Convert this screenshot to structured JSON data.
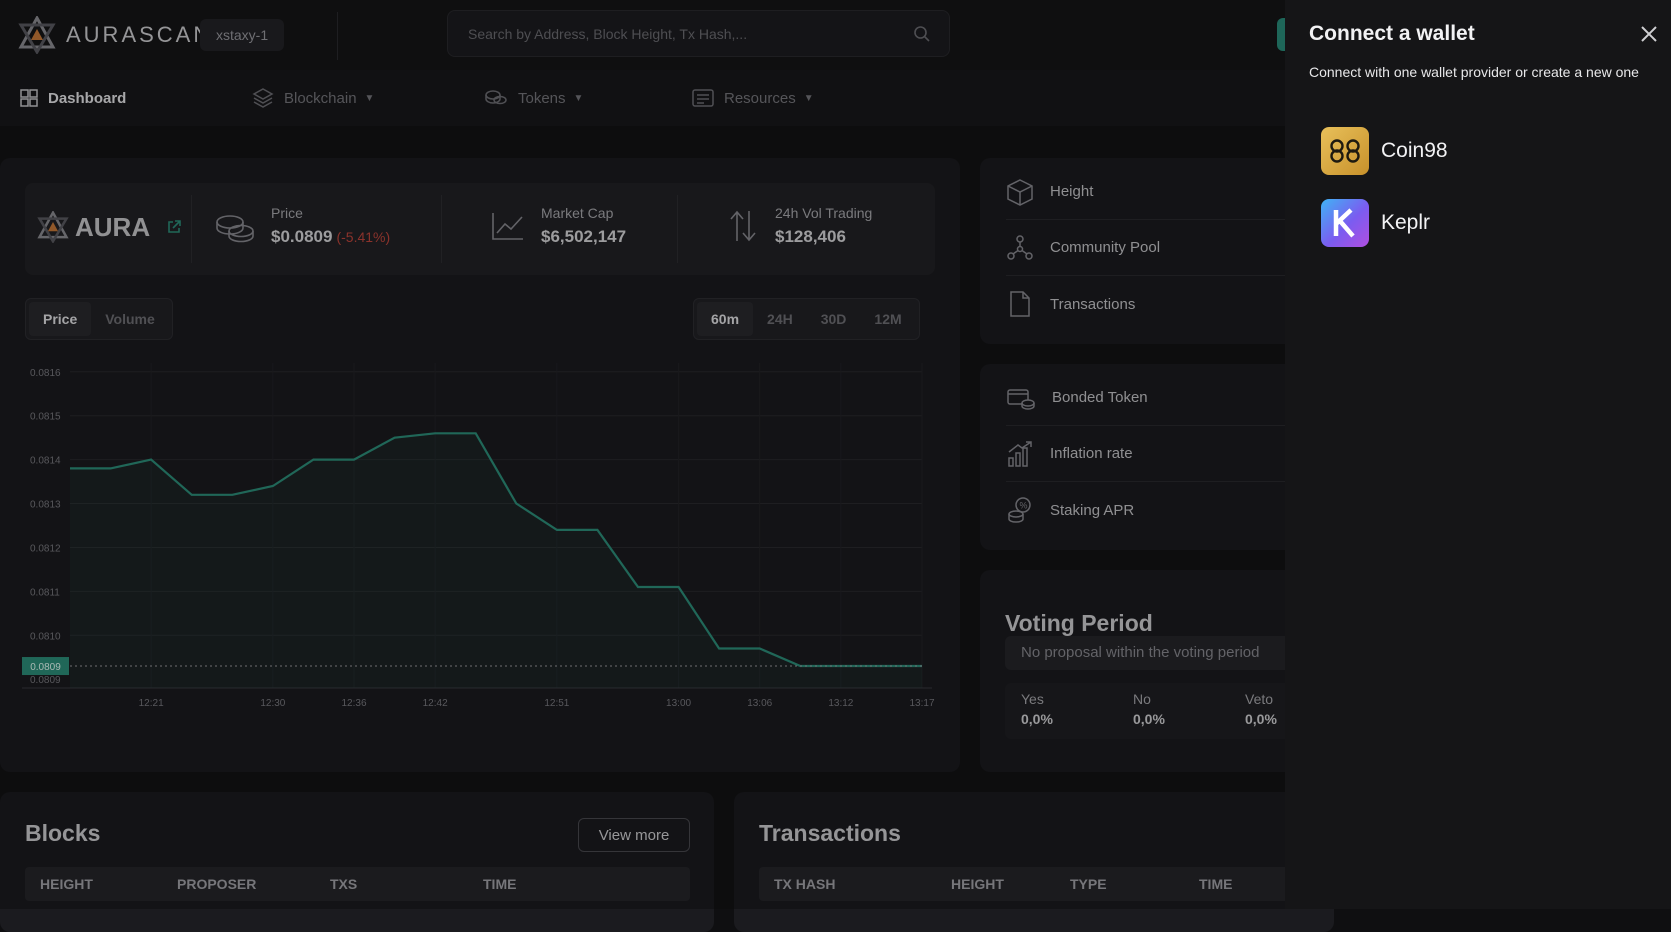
{
  "header": {
    "brand": "AURASCAN",
    "network": "xstaxy-1",
    "search_placeholder": "Search by Address, Block Height, Tx Hash,..."
  },
  "nav": {
    "dashboard": "Dashboard",
    "blockchain": "Blockchain",
    "tokens": "Tokens",
    "resources": "Resources"
  },
  "stats": {
    "token": "AURA",
    "price_label": "Price",
    "price_value": "$0.0809",
    "price_change": "(-5.41%)",
    "market_cap_label": "Market Cap",
    "market_cap_value": "$6,502,147",
    "volume_label": "24h Vol Trading",
    "volume_value": "$128,406"
  },
  "chart_toggle": {
    "price": "Price",
    "volume": "Volume"
  },
  "range_toggle": {
    "r60m": "60m",
    "r24h": "24H",
    "r30d": "30D",
    "r12m": "12M"
  },
  "chart_data": {
    "type": "area",
    "x": [
      "12:16",
      "12:18",
      "12:21",
      "12:24",
      "12:27",
      "12:30",
      "12:33",
      "12:36",
      "12:39",
      "12:42",
      "12:45",
      "12:48",
      "12:51",
      "12:54",
      "12:57",
      "13:00",
      "13:03",
      "13:06",
      "13:09",
      "13:12",
      "13:15",
      "13:17"
    ],
    "values": [
      0.08138,
      0.08138,
      0.0814,
      0.08132,
      0.08132,
      0.08134,
      0.0814,
      0.0814,
      0.08145,
      0.08146,
      0.08146,
      0.0813,
      0.08124,
      0.08124,
      0.08111,
      0.08111,
      0.08097,
      0.08097,
      0.08093,
      0.08093,
      0.08093,
      0.08093
    ],
    "yticks": [
      "0.0816",
      "0.0815",
      "0.0814",
      "0.0813",
      "0.0812",
      "0.0811",
      "0.0810",
      "0.0809"
    ],
    "xticks": [
      "12:21",
      "12:30",
      "12:36",
      "12:42",
      "12:51",
      "13:00",
      "13:06",
      "13:12",
      "13:17"
    ],
    "current_label": "0.0809",
    "current_value": 0.08093,
    "ylim": [
      0.08088,
      0.08162
    ],
    "grid": true,
    "line_color": "#2d8f7b"
  },
  "network_stats": {
    "height": "Height",
    "community_pool": "Community Pool",
    "transactions": "Transactions"
  },
  "staking_stats": {
    "bonded": "Bonded Token",
    "inflation": "Inflation rate",
    "apr": "Staking APR"
  },
  "voting": {
    "title": "Voting Period",
    "empty": "No proposal within the voting period",
    "yes_label": "Yes",
    "yes_value": "0,0%",
    "no_label": "No",
    "no_value": "0,0%",
    "veto_label": "Veto",
    "veto_value": "0,0%"
  },
  "blocks": {
    "title": "Blocks",
    "view_more": "View more",
    "columns": [
      "HEIGHT",
      "PROPOSER",
      "TXS",
      "TIME"
    ]
  },
  "transactions": {
    "title": "Transactions",
    "columns": [
      "TX HASH",
      "HEIGHT",
      "TYPE",
      "TIME"
    ]
  },
  "wallet_drawer": {
    "title": "Connect a wallet",
    "subtitle": "Connect with one wallet provider or create a new one",
    "wallets": [
      {
        "name": "Coin98",
        "icon": "coin98-icon",
        "color": "#d9a93d"
      },
      {
        "name": "Keplr",
        "icon": "keplr-icon",
        "color": "#7b5cf0"
      }
    ]
  }
}
